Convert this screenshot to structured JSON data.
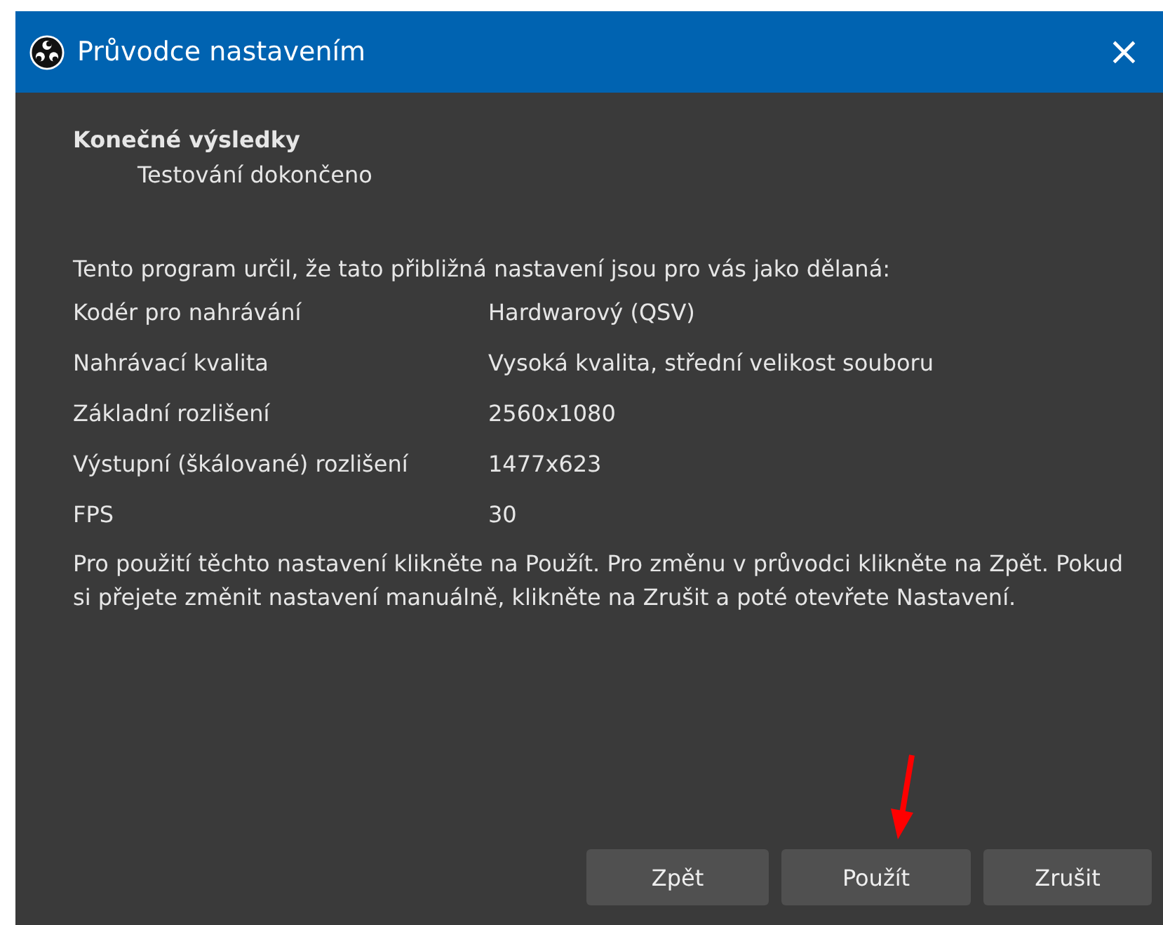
{
  "window": {
    "title": "Průvodce nastavením",
    "close": "×"
  },
  "header": {
    "title": "Konečné výsledky",
    "subtitle": "Testování dokončeno"
  },
  "intro": "Tento program určil, že tato přibližná nastavení jsou pro vás jako dělaná:",
  "settings": [
    {
      "label": "Kodér pro nahrávání",
      "value": "Hardwarový (QSV)"
    },
    {
      "label": "Nahrávací kvalita",
      "value": "Vysoká kvalita, střední velikost souboru"
    },
    {
      "label": "Základní rozlišení",
      "value": "2560x1080"
    },
    {
      "label": "Výstupní (škálované) rozlišení",
      "value": "1477x623"
    },
    {
      "label": "FPS",
      "value": "30"
    }
  ],
  "note": "Pro použití těchto nastavení klikněte na Použít. Pro změnu v průvodci klikněte na Zpět. Pokud si přejete změnit nastavení manuálně, klikněte na Zrušit a poté otevřete Nastavení.",
  "buttons": [
    "Zpět",
    "Použít",
    "Zrušit"
  ]
}
